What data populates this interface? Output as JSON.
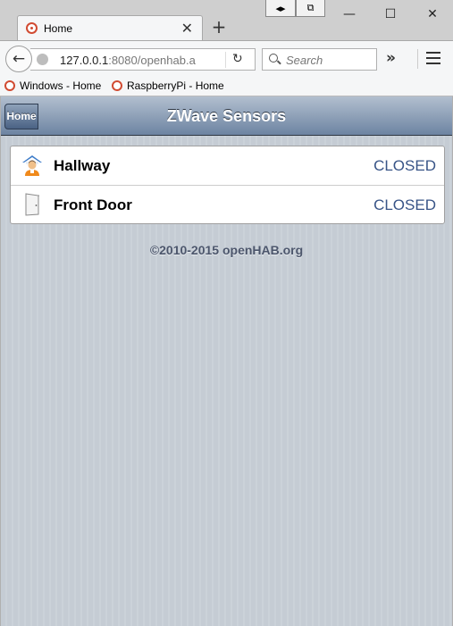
{
  "browser": {
    "tab_title": "Home",
    "new_tab_symbol": "+",
    "url_host": "127.0.0.1",
    "url_rest": ":8080/openhab.a",
    "search_placeholder": "Search",
    "bookmarks": [
      {
        "label": "Windows - Home",
        "icon": "openhab-favicon"
      },
      {
        "label": "RaspberryPi - Home",
        "icon": "openhab-favicon"
      }
    ]
  },
  "toolbar": {
    "home_label": "Home",
    "title": "ZWave Sensors"
  },
  "sensors": [
    {
      "label": "Hallway",
      "value": "CLOSED",
      "icon": "house-person-icon"
    },
    {
      "label": "Front Door",
      "value": "CLOSED",
      "icon": "door-closed-icon"
    }
  ],
  "footer": {
    "text": "©2010-2015 openHAB.org"
  }
}
